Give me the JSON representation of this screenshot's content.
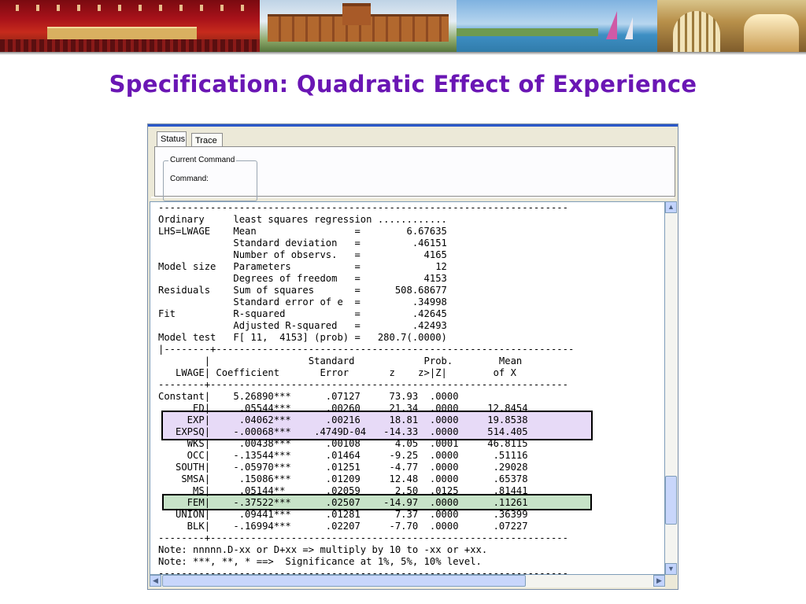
{
  "slide": {
    "title": "Specification: Quadratic Effect of Experience"
  },
  "window": {
    "tabs": [
      {
        "label": "Status",
        "active": true
      },
      {
        "label": "Trace",
        "active": false
      }
    ],
    "current_command_group": "Current Command",
    "command_label": "Command:"
  },
  "output_text": "-----------------------------------------------------------------------\nOrdinary     least squares regression ............\nLHS=LWAGE    Mean                 =        6.67635\n             Standard deviation   =         .46151\n             Number of observs.   =           4165\nModel size   Parameters           =             12\n             Degrees of freedom   =           4153\nResiduals    Sum of squares       =      508.68677\n             Standard error of e  =         .34998\nFit          R-squared            =         .42645\n             Adjusted R-squared   =         .42493\nModel test   F[ 11,  4153] (prob) =   280.7(.0000)\n|--------+--------------------------------------------------------------\n        |                 Standard            Prob.        Mean\n   LWAGE| Coefficient       Error       z    z>|Z|        of X\n--------+--------------------------------------------------------------\nConstant|    5.26890***      .07127     73.93  .0000\n      ED|     .05544***      .00260     21.34  .0000     12.8454\n     EXP|     .04062***      .00216     18.81  .0000     19.8538\n   EXPSQ|    -.00068***    .4749D-04   -14.33  .0000     514.405\n     WKS|     .00438***      .00108      4.05  .0001     46.8115\n     OCC|    -.13544***      .01464     -9.25  .0000      .51116\n   SOUTH|    -.05970***      .01251     -4.77  .0000      .29028\n    SMSA|     .15086***      .01209     12.48  .0000      .65378\n      MS|     .05144**       .02059      2.50  .0125      .81441\n     FEM|    -.37522***      .02507    -14.97  .0000      .11261\n   UNION|     .09441***      .01281      7.37  .0000      .36399\n     BLK|    -.16994***      .02207     -7.70  .0000      .07227\n--------+--------------------------------------------------------------\nNote: nnnnn.D-xx or D+xx => multiply by 10 to -xx or +xx.\nNote: ***, **, * ==>  Significance at 1%, 5%, 10% level.\n-----------------------------------------------------------------------",
  "highlights": {
    "exp_rows": [
      "EXP",
      "EXPSQ"
    ],
    "exp_color": "#e7daf7",
    "fem_row": "FEM",
    "fem_color": "#c7e3c8"
  },
  "colors": {
    "title": "#6a16b4",
    "window_bg": "#ece9d8",
    "scroll": "#c2d3fc"
  },
  "icons": {
    "scroll_up": "▲",
    "scroll_down": "▼",
    "scroll_left": "◀",
    "scroll_right": "▶"
  }
}
